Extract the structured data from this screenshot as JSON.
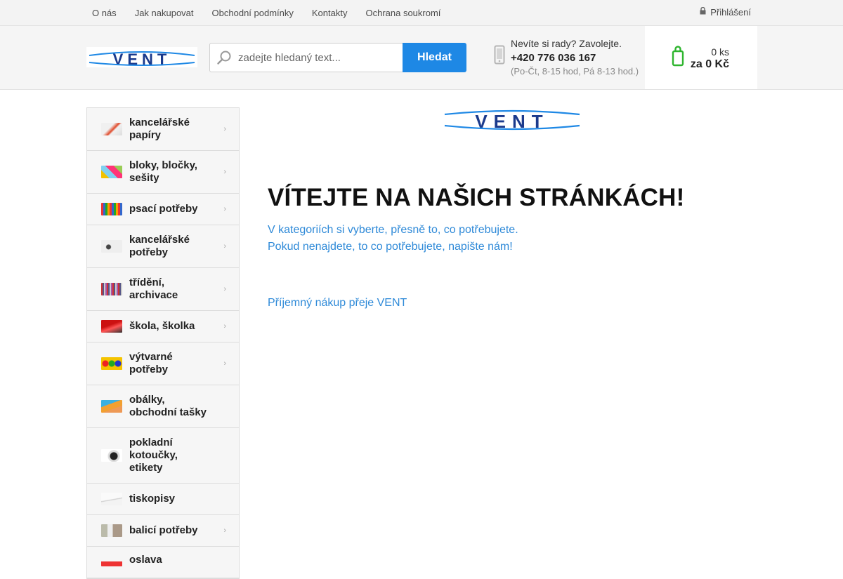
{
  "topnav": {
    "links": [
      "O nás",
      "Jak nakupovat",
      "Obchodní podmínky",
      "Kontakty",
      "Ochrana soukromí"
    ],
    "login_label": "Přihlášení",
    "login_icon": "lock-icon"
  },
  "header": {
    "logo_text": "VENT",
    "search": {
      "placeholder": "zadejte hledaný text...",
      "button": "Hledat"
    },
    "help": {
      "question": "Nevíte si rady? Zavolejte.",
      "phone": "+420 776 036 167",
      "hours": "(Po-Čt, 8-15 hod, Pá 8-13 hod.)"
    },
    "cart": {
      "qty": "0 ks",
      "total": "za 0 Kč",
      "accent": "#2fb52f"
    }
  },
  "categories": [
    {
      "label": "kancelářské papíry",
      "has_arrow": true
    },
    {
      "label": "bloky, bločky, sešity",
      "has_arrow": true
    },
    {
      "label": "psací potřeby",
      "has_arrow": true
    },
    {
      "label": "kancelářské potřeby",
      "has_arrow": true
    },
    {
      "label": "třídění, archivace",
      "has_arrow": true
    },
    {
      "label": "škola, školka",
      "has_arrow": true
    },
    {
      "label": "výtvarné potřeby",
      "has_arrow": true
    },
    {
      "label": "obálky, obchodní tašky",
      "has_arrow": false
    },
    {
      "label": "pokladní kotoučky, etikety",
      "has_arrow": false
    },
    {
      "label": "tiskopisy",
      "has_arrow": false
    },
    {
      "label": "balicí potřeby",
      "has_arrow": true
    },
    {
      "label": "oslava",
      "has_arrow": false
    }
  ],
  "main": {
    "logo_text": "VENT",
    "welcome": "VÍTEJTE NA NAŠICH STRÁNKÁCH!",
    "line1": "V kategoriích si vyberte, přesně to, co potřebujete.",
    "line2": "Pokud nenajdete, to co potřebujete, napište nám!",
    "line3": "Příjemný nákup přeje VENT"
  },
  "colors": {
    "brand_blue": "#1e88e5",
    "brand_navy": "#1b3a8c",
    "link_blue": "#2f8ad8"
  }
}
